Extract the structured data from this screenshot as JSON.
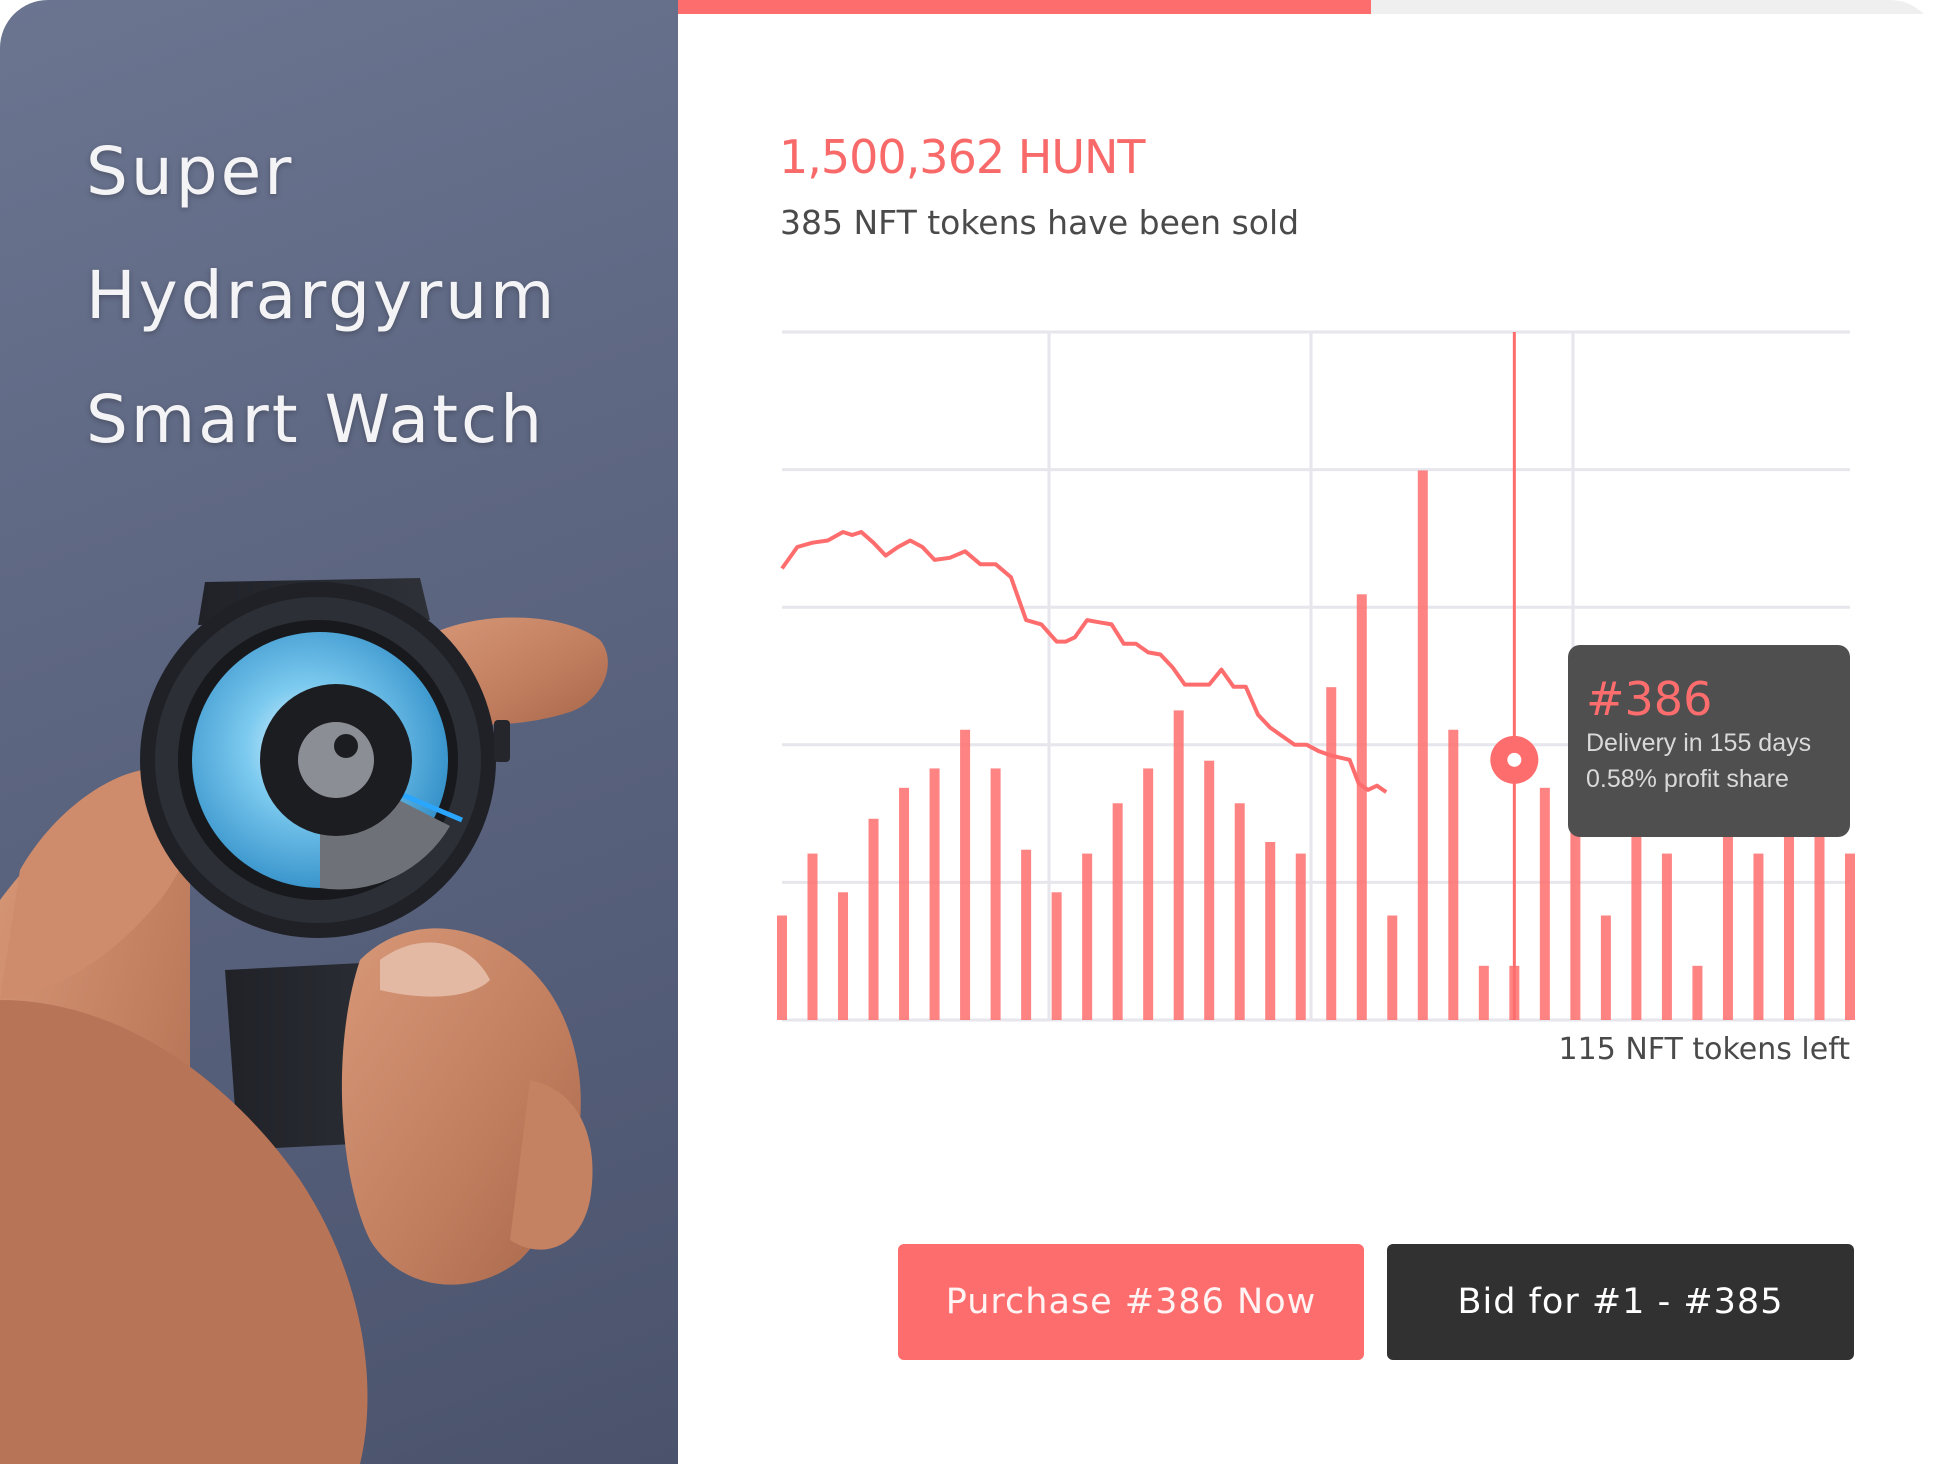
{
  "hero": {
    "title_lines": [
      "Super",
      "Hydrargyrum",
      "Smart Watch"
    ]
  },
  "sale": {
    "progress": 0.55,
    "total": "1,500,362 HUNT",
    "sold_text": "385 NFT tokens have been sold",
    "left_text": "115 NFT tokens left"
  },
  "tooltip": {
    "id": "#386",
    "delivery": "Delivery in 155 days",
    "profit": "0.58% profit share"
  },
  "actions": {
    "purchase_label": "Purchase #386 Now",
    "bid_label": "Bid for #1 - #385"
  },
  "colors": {
    "accent": "#fe6d6d",
    "dark": "#313131",
    "grid": "#e6e6ec"
  },
  "chart_data": {
    "type": "line",
    "title": "",
    "xlabel": "",
    "ylabel": "",
    "grid": true,
    "line_index": [
      0,
      0.5,
      1,
      1.5,
      2,
      2.3,
      2.6,
      3,
      3.4,
      3.8,
      4.2,
      4.6,
      5,
      5.5,
      6,
      6.5,
      7,
      7.5,
      8,
      8.5,
      9,
      9.3,
      9.6,
      10,
      10.4,
      10.8,
      11.2,
      11.6,
      12,
      12.4,
      12.8,
      13.2,
      13.6,
      14,
      14.4,
      14.8,
      15.2,
      15.6,
      16,
      16.4,
      16.8,
      17.2,
      17.6,
      18,
      18.3,
      18.6,
      18.9,
      19.2,
      19.5,
      19.8,
      20.2,
      20.6,
      21,
      21.4,
      21.8,
      22.2,
      22.6,
      23,
      23.3
    ],
    "line_values": [
      55,
      50,
      49,
      48.5,
      46.5,
      47.2,
      46.5,
      49,
      52,
      50,
      48.5,
      50,
      53,
      52.5,
      51,
      54,
      54,
      57,
      67,
      68,
      72,
      72,
      71,
      67,
      67.5,
      68,
      72.5,
      72.5,
      74.5,
      75,
      78,
      82,
      82,
      82,
      78.5,
      82.5,
      82.5,
      89,
      92,
      94,
      96,
      96,
      97.5,
      98.5,
      99,
      99.5,
      105,
      106.5,
      105.5,
      107
    ],
    "bar_values": [
      27,
      43,
      33,
      52,
      60,
      65,
      75,
      65,
      44,
      33,
      43,
      56,
      65,
      80,
      67,
      56,
      46,
      43,
      86,
      110,
      27,
      142,
      75,
      14,
      14,
      60,
      75,
      27,
      52,
      43,
      14,
      52,
      43,
      67,
      52,
      43
    ],
    "marker_index": 21,
    "marker_value": 99.5,
    "visible_y_range": [
      0,
      100
    ]
  }
}
